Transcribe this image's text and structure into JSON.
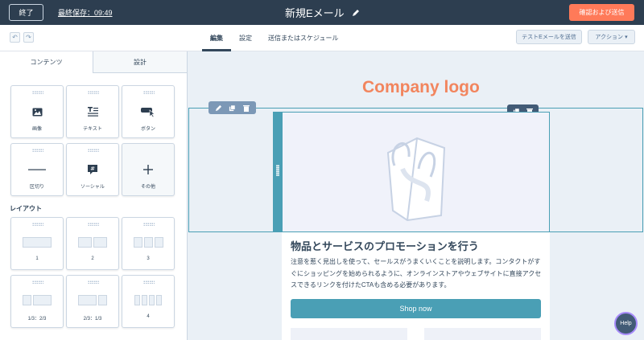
{
  "topbar": {
    "exit_label": "終了",
    "last_saved": "最終保存：09:49",
    "title": "新規Eメール",
    "review_send_label": "確認および送信"
  },
  "subbar": {
    "tabs": [
      {
        "label": "編集",
        "active": true
      },
      {
        "label": "設定",
        "active": false
      },
      {
        "label": "送信またはスケジュール",
        "active": false
      }
    ],
    "test_email_label": "テストEメールを送信",
    "action_label": "アクション"
  },
  "left_panel": {
    "tabs": [
      {
        "label": "コンテンツ",
        "active": true
      },
      {
        "label": "設計",
        "active": false
      }
    ],
    "modules": [
      {
        "label": "画像",
        "icon": "image-icon"
      },
      {
        "label": "テキスト",
        "icon": "text-icon"
      },
      {
        "label": "ボタン",
        "icon": "button-icon"
      },
      {
        "label": "区切り",
        "icon": "divider-icon"
      },
      {
        "label": "ソーシャル",
        "icon": "social-icon"
      },
      {
        "label": "その他",
        "icon": "plus-icon"
      }
    ],
    "layout_heading": "レイアウト",
    "layouts": [
      {
        "label": "1"
      },
      {
        "label": "2"
      },
      {
        "label": "3"
      },
      {
        "label": "1/3：2/3"
      },
      {
        "label": "2/3：1/3"
      },
      {
        "label": "4"
      }
    ]
  },
  "canvas": {
    "logo_text": "Company logo",
    "headline": "物品とサービスのプロモーションを行う",
    "paragraph": "注意を惹く見出しを使って、セールスがうまくいくことを説明します。コンタクトがすぐにショッピングを始められるように、オンラインストアやウェブサイトに直接アクセスできるリンクを付けたCTAも含める必要があります。",
    "button_label": "Shop now"
  },
  "help_label": "Help",
  "colors": {
    "topbar": "#2d3e50",
    "accent_orange": "#ff7a59",
    "teal": "#4a9fb5",
    "logo": "#f2855e"
  }
}
